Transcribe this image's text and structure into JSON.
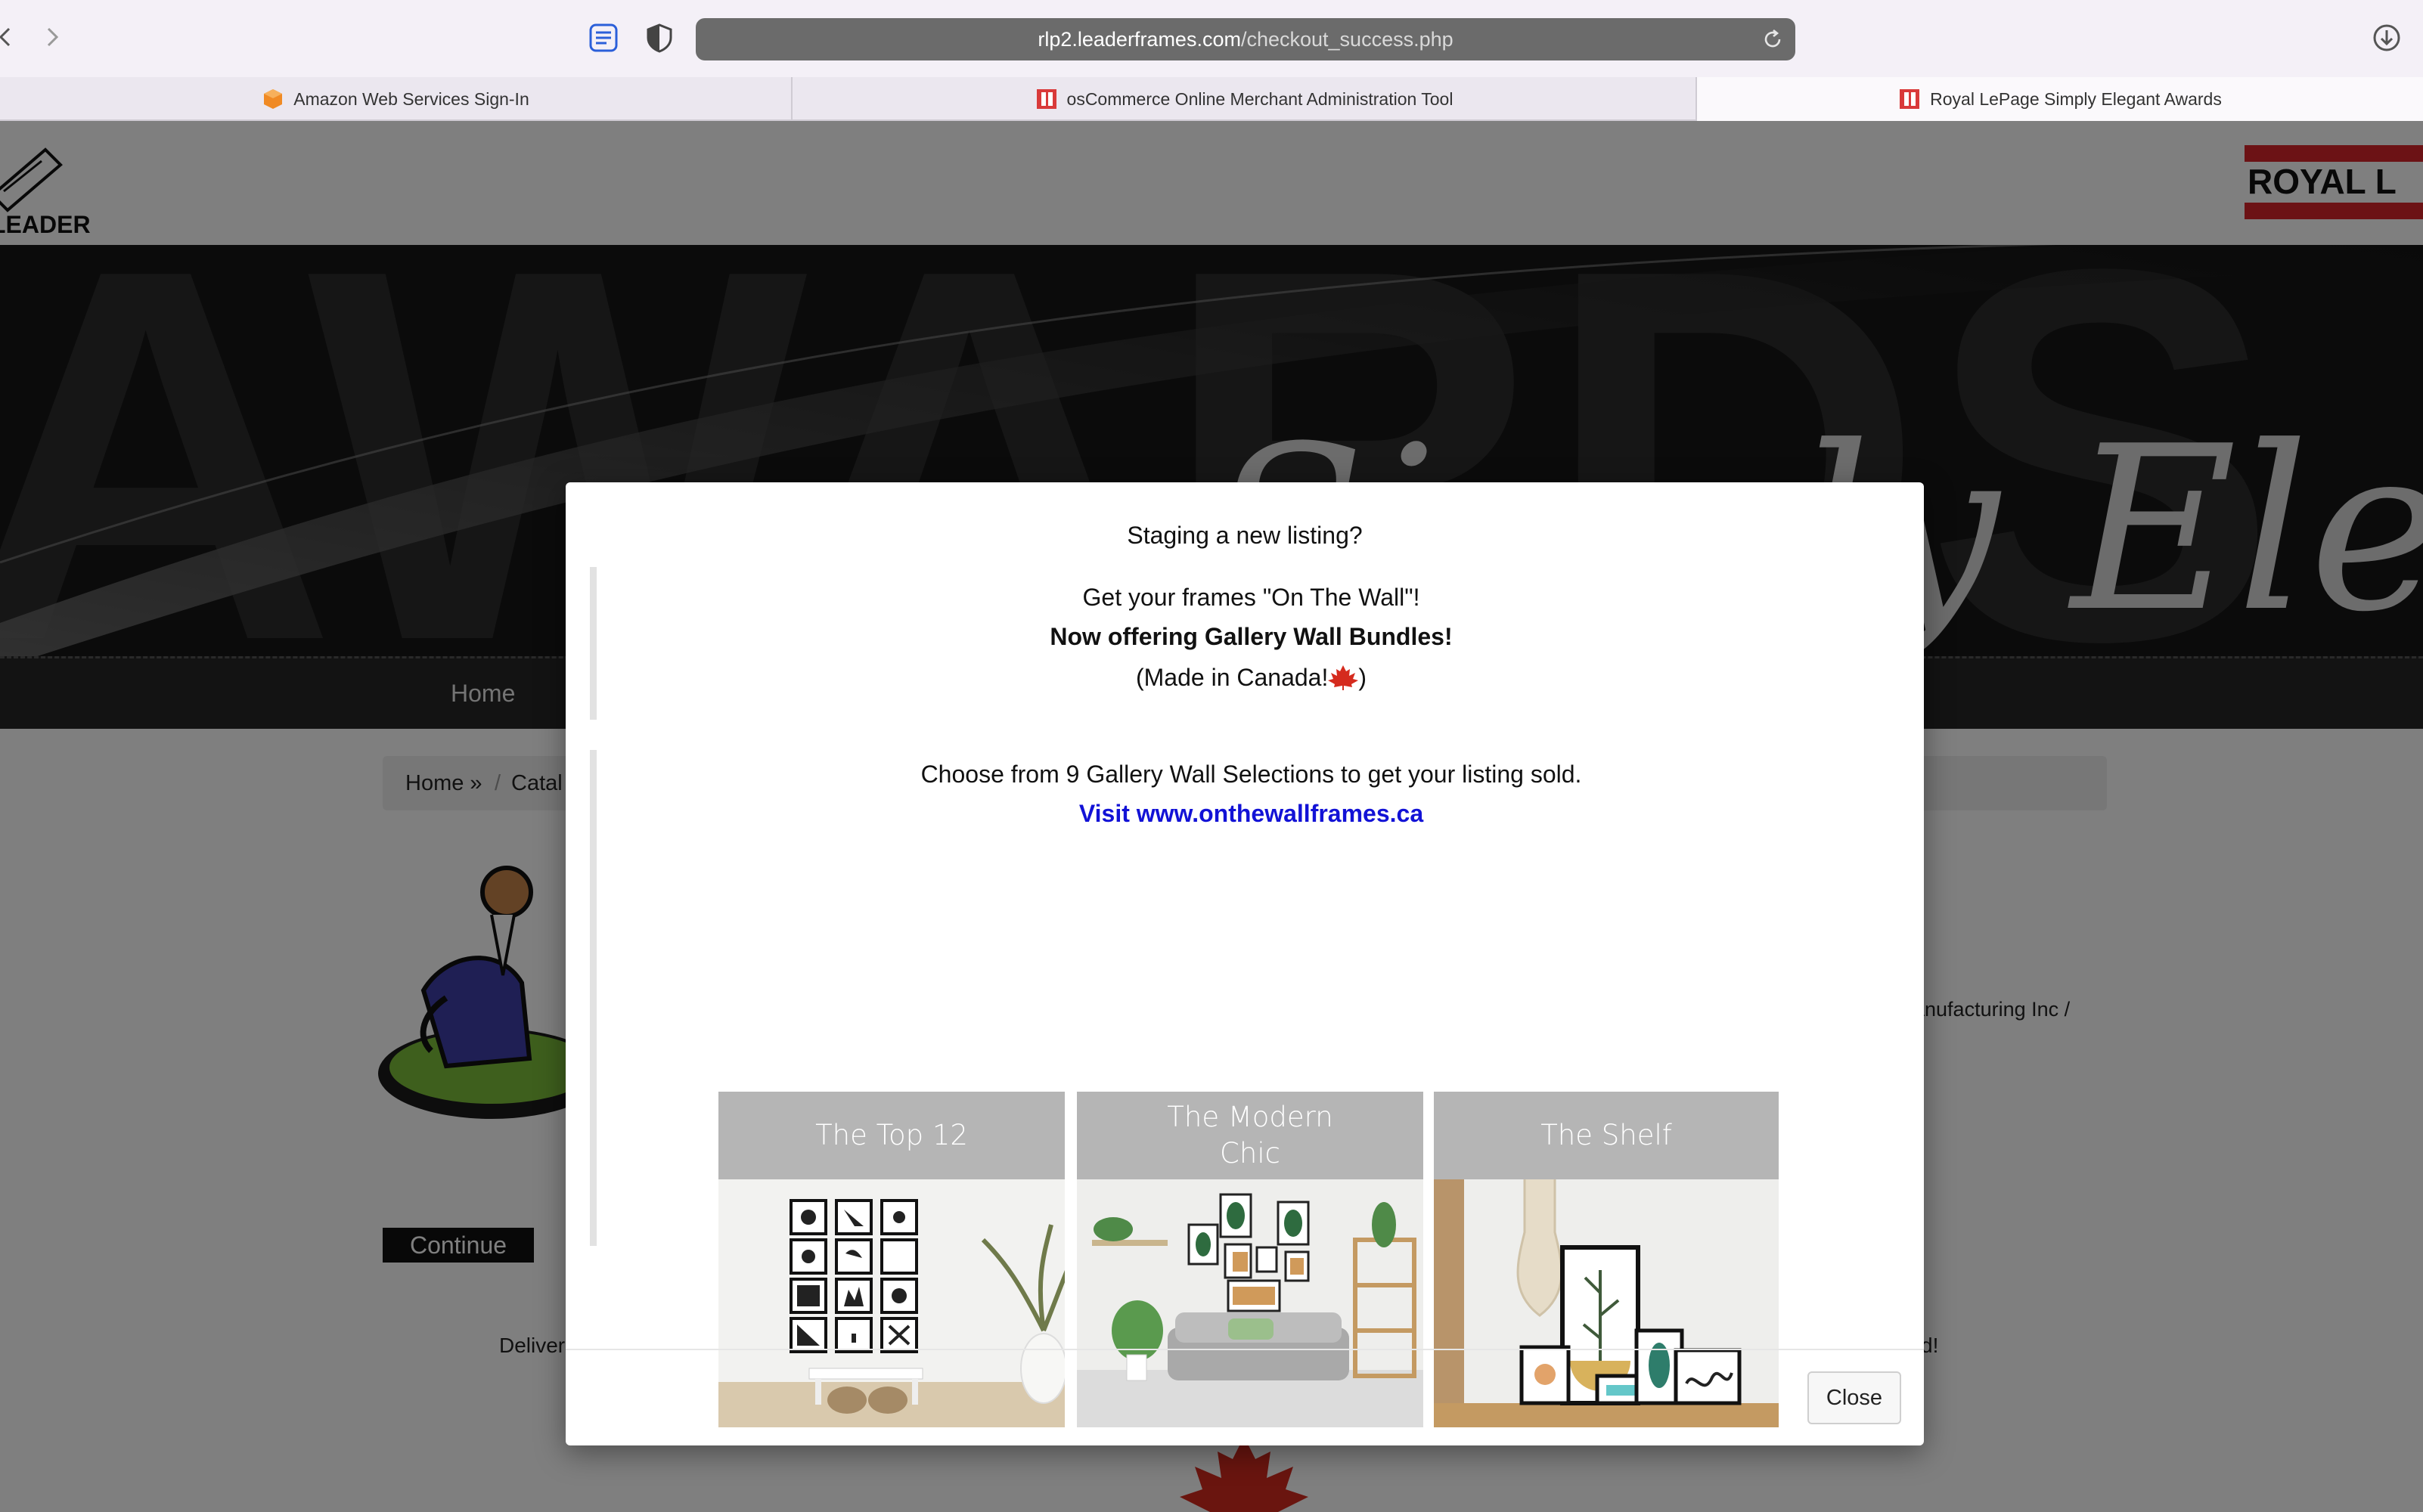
{
  "browser": {
    "url_host": "rlp2.leaderframes.com",
    "url_path": "/checkout_success.php",
    "tabs": [
      {
        "label": "Amazon Web Services Sign-In"
      },
      {
        "label": "osCommerce Online Merchant Administration Tool"
      },
      {
        "label": "Royal LePage Simply Elegant Awards"
      }
    ]
  },
  "site": {
    "logo_left_text": "LEADER FRAMES",
    "logo_right_text": "ROYAL L",
    "banner_bg_text": "AWARDS",
    "banner_script_text": "Simply Elegant",
    "menu_home": "Home",
    "breadcrumb": {
      "home": "Home »",
      "sep": "/",
      "current": "Catal"
    },
    "side_text": "anufacturing Inc /",
    "continue_label": "Continue",
    "deliver_text": "Deliver",
    "deliver_end": "d!"
  },
  "modal": {
    "title": "Staging a new listing?",
    "line1": "Get your frames \"On The Wall\"!",
    "line2": "Now offering Gallery Wall Bundles!",
    "line3_prefix": "(Made in Canada!",
    "line3_suffix": ")",
    "choose_text": "Choose from 9 Gallery Wall Selections to get your listing sold.",
    "visit_link": "Visit www.onthewallframes.ca",
    "galleries": [
      {
        "title": "The Top 12"
      },
      {
        "title": "The Modern Chic"
      },
      {
        "title": "The Shelf"
      }
    ],
    "close_label": "Close"
  },
  "colors": {
    "link": "#1212d6",
    "overlay": "rgba(0,0,0,0.5)",
    "gallery_header": "#b5b5b5",
    "url_bar": "#6b6b6b"
  }
}
